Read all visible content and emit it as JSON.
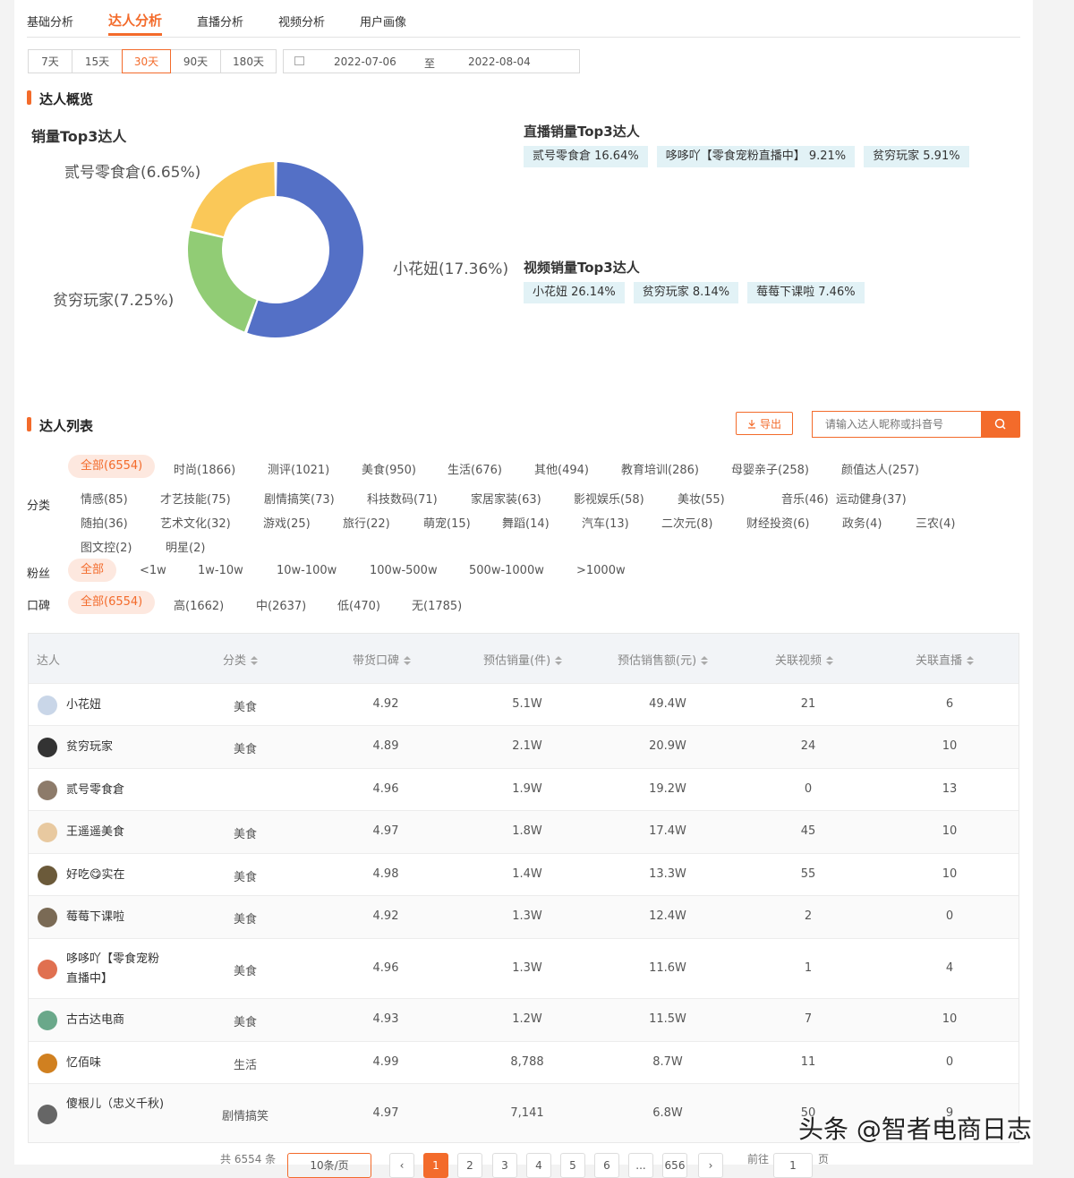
{
  "tabs": [
    "基础分析",
    "达人分析",
    "直播分析",
    "视频分析",
    "用户画像"
  ],
  "active_tab": "达人分析",
  "ranges": [
    "7天",
    "15天",
    "30天",
    "90天",
    "180天"
  ],
  "active_range": "30天",
  "date_start": "2022-07-06",
  "date_sep": "至",
  "date_end": "2022-08-04",
  "overview_title": "达人概览",
  "top3_title": "销量Top3达人",
  "donut": {
    "slices": [
      {
        "label": "小花妞(17.36%)",
        "value": 17.36,
        "color": "#5470c6"
      },
      {
        "label": "贫穷玩家(7.25%)",
        "value": 7.25,
        "color": "#91cc75"
      },
      {
        "label": "贰号零食倉(6.65%)",
        "value": 6.65,
        "color": "#fac858"
      }
    ]
  },
  "live_title": "直播销量Top3达人",
  "live_tags": [
    "贰号零食倉  16.64%",
    "哆哆吖【零食宠粉直播中】  9.21%",
    "贫穷玩家  5.91%"
  ],
  "video_title": "视频销量Top3达人",
  "video_tags": [
    "小花妞  26.14%",
    "贫穷玩家  8.14%",
    "莓莓下课啦  7.46%"
  ],
  "list_title": "达人列表",
  "export_label": "导出",
  "search_placeholder": "请输入达人昵称或抖音号",
  "category_label": "分类",
  "categories": [
    [
      "全部(6554)",
      "时尚(1866)",
      "测评(1021)",
      "美食(950)",
      "生活(676)",
      "其他(494)",
      "教育培训(286)",
      "母婴亲子(258)",
      "颜值达人(257)"
    ],
    [
      "情感(85)",
      "才艺技能(75)",
      "剧情搞笑(73)",
      "科技数码(71)",
      "家居家装(63)",
      "影视娱乐(58)",
      "美妆(55)",
      "音乐(46)",
      "运动健身(37)"
    ],
    [
      "随拍(36)",
      "艺术文化(32)",
      "游戏(25)",
      "旅行(22)",
      "萌宠(15)",
      "舞蹈(14)",
      "汽车(13)",
      "二次元(8)",
      "财经投资(6)",
      "政务(4)",
      "三农(4)"
    ],
    [
      "图文控(2)",
      "明星(2)"
    ]
  ],
  "fans_label": "粉丝",
  "fans": [
    "全部",
    "<1w",
    "1w-10w",
    "10w-100w",
    "100w-500w",
    "500w-1000w",
    ">1000w"
  ],
  "rep_label": "口碑",
  "reputation": [
    "全部(6554)",
    "高(1662)",
    "中(2637)",
    "低(470)",
    "无(1785)"
  ],
  "columns": [
    "达人",
    "分类",
    "带货口碑",
    "预估销量(件)",
    "预估销售额(元)",
    "关联视频",
    "关联直播"
  ],
  "rows": [
    {
      "name": "小花妞",
      "category": "美食",
      "score": "4.92",
      "sales": "5.1W",
      "amount": "49.4W",
      "videos": "21",
      "lives": "6",
      "avatar": "#c9d6e8"
    },
    {
      "name": "贫穷玩家",
      "category": "美食",
      "score": "4.89",
      "sales": "2.1W",
      "amount": "20.9W",
      "videos": "24",
      "lives": "10",
      "avatar": "#333333"
    },
    {
      "name": "贰号零食倉",
      "category": "",
      "score": "4.96",
      "sales": "1.9W",
      "amount": "19.2W",
      "videos": "0",
      "lives": "13",
      "avatar": "#8d7b6a"
    },
    {
      "name": "王遥遥美食",
      "category": "美食",
      "score": "4.97",
      "sales": "1.8W",
      "amount": "17.4W",
      "videos": "45",
      "lives": "10",
      "avatar": "#e8c9a0"
    },
    {
      "name": "好吃😋实在",
      "category": "美食",
      "score": "4.98",
      "sales": "1.4W",
      "amount": "13.3W",
      "videos": "55",
      "lives": "10",
      "avatar": "#6b5a3a"
    },
    {
      "name": "莓莓下课啦",
      "category": "美食",
      "score": "4.92",
      "sales": "1.3W",
      "amount": "12.4W",
      "videos": "2",
      "lives": "0",
      "avatar": "#7a6a55"
    },
    {
      "name": "哆哆吖【零食宠粉直播中】",
      "category": "美食",
      "score": "4.96",
      "sales": "1.3W",
      "amount": "11.6W",
      "videos": "1",
      "lives": "4",
      "avatar": "#e07050"
    },
    {
      "name": "古古达电商",
      "category": "美食",
      "score": "4.93",
      "sales": "1.2W",
      "amount": "11.5W",
      "videos": "7",
      "lives": "10",
      "avatar": "#6aa88a"
    },
    {
      "name": "忆佰味",
      "category": "生活",
      "score": "4.99",
      "sales": "8,788",
      "amount": "8.7W",
      "videos": "11",
      "lives": "0",
      "avatar": "#d08020"
    },
    {
      "name": "傻根儿（忠义千秋)",
      "category": "剧情搞笑",
      "score": "4.97",
      "sales": "7,141",
      "amount": "6.8W",
      "videos": "50",
      "lives": "9",
      "avatar": "#666666"
    }
  ],
  "pager": {
    "total": "共 6554 条",
    "per_page": "10条/页",
    "pages": [
      "1",
      "2",
      "3",
      "4",
      "5",
      "6",
      "...",
      "656"
    ],
    "goto": "前往",
    "goto_value": "1",
    "page_unit": "页"
  },
  "watermark": "头条 @智者电商日志"
}
